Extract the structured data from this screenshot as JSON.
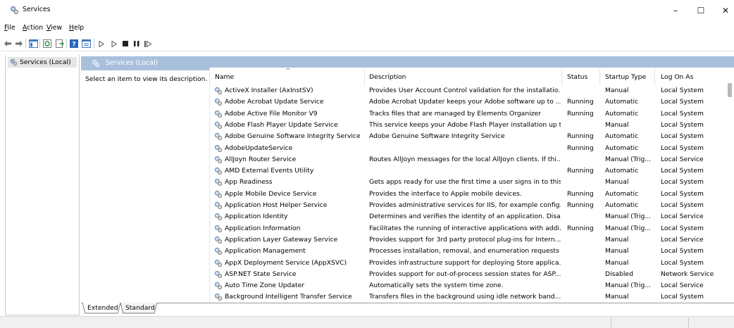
{
  "window": {
    "title": "Services",
    "minimize_glyph": "–",
    "maximize_glyph": "☐",
    "close_glyph": "✕"
  },
  "menu": [
    {
      "label": "File",
      "mnemonic": "F",
      "rest": "ile"
    },
    {
      "label": "Action",
      "mnemonic": "A",
      "rest": "ction"
    },
    {
      "label": "View",
      "mnemonic": "V",
      "rest": "iew"
    },
    {
      "label": "Help",
      "mnemonic": "H",
      "rest": "elp"
    }
  ],
  "toolbar": {
    "icons": [
      "back-arrow-icon",
      "forward-arrow-icon",
      "console-tree-icon",
      "refresh-icon",
      "export-list-icon",
      "help-icon",
      "properties-icon",
      "start-service-icon",
      "start-service-alt-icon",
      "stop-service-icon",
      "pause-service-icon",
      "resume-service-icon"
    ]
  },
  "tree": {
    "root_label": "Services (Local)"
  },
  "pane": {
    "header_label": "Services (Local)",
    "description_prompt": "Select an item to view its description."
  },
  "columns": {
    "name": "Name",
    "description": "Description",
    "status": "Status",
    "startup_type": "Startup Type",
    "log_on_as": "Log On As",
    "sort_indicator": "^"
  },
  "services": [
    {
      "name": "ActiveX Installer (AxInstSV)",
      "description": "Provides User Account Control validation for the installatio...",
      "status": "",
      "startup": "Manual",
      "logon": "Local System"
    },
    {
      "name": "Adobe Acrobat Update Service",
      "description": "Adobe Acrobat Updater keeps your Adobe software up to ...",
      "status": "Running",
      "startup": "Automatic",
      "logon": "Local System"
    },
    {
      "name": "Adobe Active File Monitor V9",
      "description": "Tracks files that are managed by Elements Organizer",
      "status": "Running",
      "startup": "Automatic",
      "logon": "Local System"
    },
    {
      "name": "Adobe Flash Player Update Service",
      "description": "This service keeps your Adobe Flash Player installation up t...",
      "status": "",
      "startup": "Manual",
      "logon": "Local System"
    },
    {
      "name": "Adobe Genuine Software Integrity Service",
      "description": "Adobe Genuine Software Integrity Service",
      "status": "Running",
      "startup": "Automatic",
      "logon": "Local System"
    },
    {
      "name": "AdobeUpdateService",
      "description": "",
      "status": "Running",
      "startup": "Automatic",
      "logon": "Local System"
    },
    {
      "name": "AllJoyn Router Service",
      "description": "Routes AllJoyn messages for the local AllJoyn clients. If thi...",
      "status": "",
      "startup": "Manual (Trig...",
      "logon": "Local Service"
    },
    {
      "name": "AMD External Events Utility",
      "description": "",
      "status": "Running",
      "startup": "Automatic",
      "logon": "Local System"
    },
    {
      "name": "App Readiness",
      "description": "Gets apps ready for use the first time a user signs in to this ...",
      "status": "",
      "startup": "Manual",
      "logon": "Local System"
    },
    {
      "name": "Apple Mobile Device Service",
      "description": "Provides the interface to Apple mobile devices.",
      "status": "Running",
      "startup": "Automatic",
      "logon": "Local System"
    },
    {
      "name": "Application Host Helper Service",
      "description": "Provides administrative services for IIS, for example config...",
      "status": "Running",
      "startup": "Automatic",
      "logon": "Local System"
    },
    {
      "name": "Application Identity",
      "description": "Determines and verifies the identity of an application. Disa...",
      "status": "",
      "startup": "Manual (Trig...",
      "logon": "Local Service"
    },
    {
      "name": "Application Information",
      "description": "Facilitates the running of interactive applications with addi...",
      "status": "Running",
      "startup": "Manual (Trig...",
      "logon": "Local System"
    },
    {
      "name": "Application Layer Gateway Service",
      "description": "Provides support for 3rd party protocol plug-ins for Intern...",
      "status": "",
      "startup": "Manual",
      "logon": "Local Service"
    },
    {
      "name": "Application Management",
      "description": "Processes installation, removal, and enumeration requests ...",
      "status": "",
      "startup": "Manual",
      "logon": "Local System"
    },
    {
      "name": "AppX Deployment Service (AppXSVC)",
      "description": "Provides infrastructure support for deploying Store applica...",
      "status": "",
      "startup": "Manual",
      "logon": "Local System"
    },
    {
      "name": "ASP.NET State Service",
      "description": "Provides support for out-of-process session states for ASP....",
      "status": "",
      "startup": "Disabled",
      "logon": "Network Service"
    },
    {
      "name": "Auto Time Zone Updater",
      "description": "Automatically sets the system time zone.",
      "status": "",
      "startup": "Manual (Trig...",
      "logon": "Local Service"
    },
    {
      "name": "Background Intelligent Transfer Service",
      "description": "Transfers files in the background using idle network band...",
      "status": "",
      "startup": "Manual",
      "logon": "Local System"
    }
  ],
  "tabs": [
    {
      "label": "Extended"
    },
    {
      "label": "Standard"
    }
  ],
  "colors": {
    "pane_header_bg": "#a9c0dc",
    "selected_tree_bg": "#e5e5e5"
  }
}
